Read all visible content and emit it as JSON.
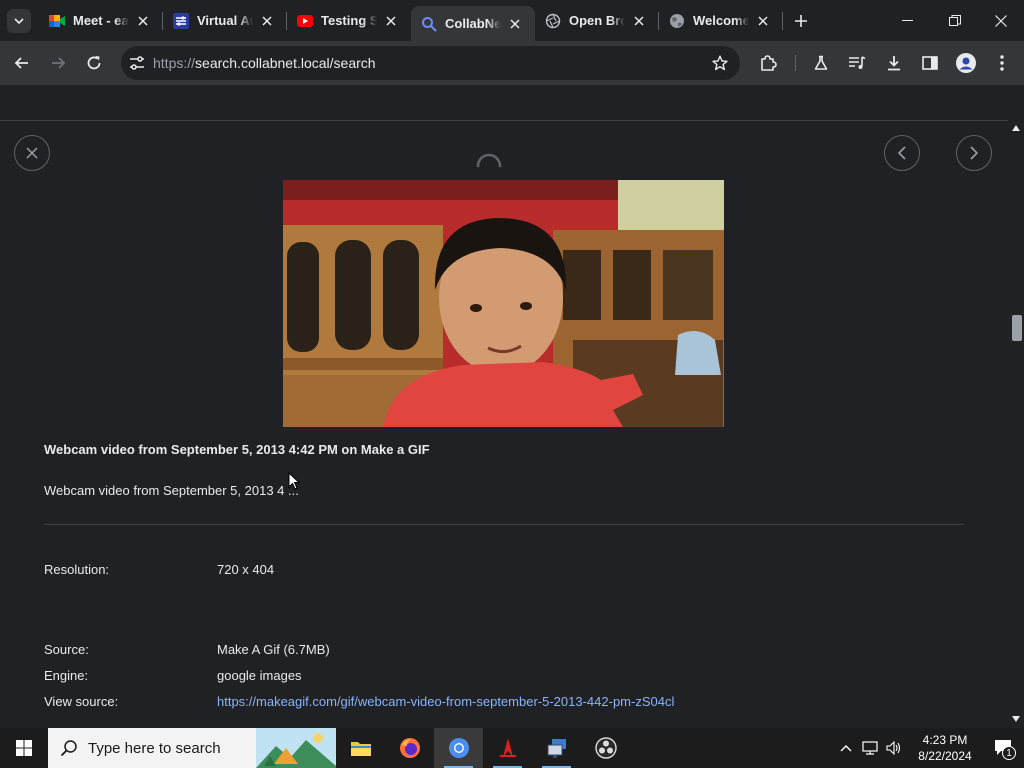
{
  "tabs": [
    {
      "title": "Meet - eaj",
      "icon": "google-meet-icon",
      "active": false
    },
    {
      "title": "Virtual Au",
      "icon": "virtual-audio-icon",
      "active": false
    },
    {
      "title": "Testing So",
      "icon": "youtube-icon",
      "active": false
    },
    {
      "title": "CollabNet",
      "icon": "search-magnifier-icon",
      "active": true
    },
    {
      "title": "Open Brow",
      "icon": "open-browser-icon",
      "active": false
    },
    {
      "title": "Welcome",
      "icon": "globe-icon",
      "active": false
    }
  ],
  "address_bar": {
    "scheme": "https://",
    "host_path": "search.collabnet.local/search"
  },
  "result": {
    "title": "Webcam video from September 5, 2013 4:42 PM on Make a GIF",
    "description": "Webcam video from September 5, 2013 4 ...",
    "metadata": [
      {
        "label": "Resolution:",
        "value": "720 x 404"
      },
      {
        "label": "Source:",
        "value": "Make A Gif (6.7MB)"
      },
      {
        "label": "Engine:",
        "value": "google images"
      },
      {
        "label": "View source:",
        "value": "https://makeagif.com/gif/webcam-video-from-september-5-2013-442-pm-zS04cl"
      }
    ]
  },
  "taskbar": {
    "search_placeholder": "Type here to search",
    "time": "4:23 PM",
    "date": "8/22/2024",
    "notification_count": "1"
  },
  "colors": {
    "page_bg": "#202124",
    "toolbar_bg": "#35363a",
    "link": "#8ab4f8"
  }
}
